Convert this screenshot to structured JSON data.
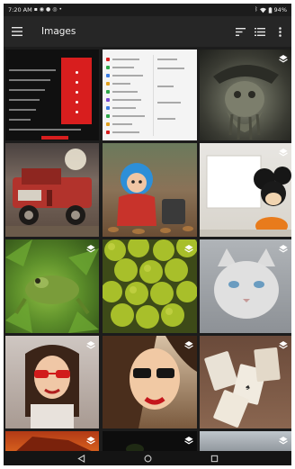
{
  "status_bar": {
    "time": "7:20 AM",
    "battery": "94%"
  },
  "app_bar": {
    "title": "Images"
  },
  "icons": {
    "menu": "hamburger-menu-icon",
    "sort": "sort-icon",
    "view": "list-view-icon",
    "overflow": "more-vert-icon",
    "stack": "stack-layers-icon",
    "back": "back-triangle-icon",
    "home": "home-circle-icon",
    "recents": "recents-square-icon"
  },
  "colors": {
    "app_bar": "#262626",
    "background": "#1c1c1c",
    "accent_red": "#d81e1e"
  },
  "gallery": {
    "tiles": [
      {
        "subject": "app-settings-screenshot",
        "badge": false
      },
      {
        "subject": "app-settings-list-screenshot",
        "badge": false
      },
      {
        "subject": "pirate-statue",
        "badge": true
      },
      {
        "subject": "old-red-truck",
        "badge": false
      },
      {
        "subject": "child-in-leaves",
        "badge": false
      },
      {
        "subject": "mickey-toy",
        "badge": true
      },
      {
        "subject": "green-frog",
        "badge": true
      },
      {
        "subject": "green-citrus",
        "badge": true
      },
      {
        "subject": "grey-cat",
        "badge": true
      },
      {
        "subject": "woman-red-glasses",
        "badge": true
      },
      {
        "subject": "woman-red-glasses-closeup",
        "badge": true
      },
      {
        "subject": "playing-cards",
        "badge": true
      },
      {
        "subject": "partial-photo-1",
        "badge": true
      },
      {
        "subject": "partial-photo-2",
        "badge": true
      },
      {
        "subject": "partial-photo-3",
        "badge": true
      }
    ]
  }
}
